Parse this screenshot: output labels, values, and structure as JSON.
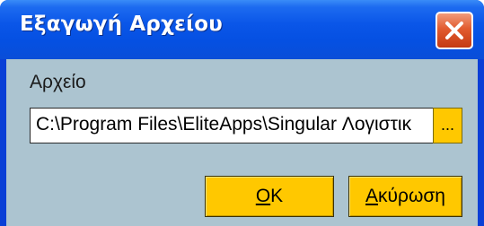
{
  "window": {
    "title": "Εξαγωγή Αρχείου",
    "close_icon": "close-x-icon"
  },
  "form": {
    "file_label": "Αρχείο",
    "file_path_value": "C:\\Program Files\\EliteApps\\Singular Λογιστικ",
    "browse_label": "..."
  },
  "buttons": {
    "ok_mnemonic": "O",
    "ok_rest": "K",
    "cancel_mnemonic": "Α",
    "cancel_rest": "κύρωση"
  },
  "colors": {
    "titlebar": "#0a56e8",
    "client_background": "#acc4d0",
    "button_accent": "#ffc800",
    "close_button": "#e25b2f"
  }
}
